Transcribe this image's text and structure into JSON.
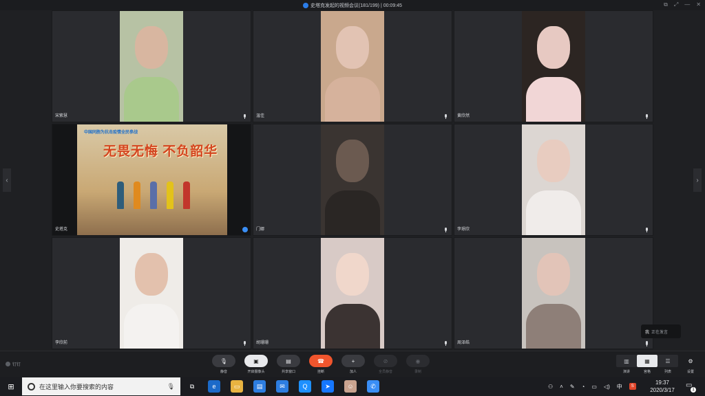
{
  "window": {
    "title": "史塔克发起的视频会议(181/199) | 00:09:45",
    "controls": [
      "⧉",
      "⤢",
      "—",
      "✕"
    ]
  },
  "participants": [
    {
      "name": "宋紫慧",
      "skin": "#d8b6a0",
      "bg": "#b7c2a4",
      "shirt": "#a9c98c"
    },
    {
      "name": "温佳",
      "skin": "#e2c3b3",
      "bg": "#c9a88d",
      "shirt": "#d6b29c"
    },
    {
      "name": "黄欣然",
      "skin": "#e7c9c2",
      "bg": "#2c2522",
      "shirt": "#f1d6d6"
    },
    {
      "name": "史塔克",
      "shared": true
    },
    {
      "name": "门娜",
      "skin": "#6b5a50",
      "bg": "#3a3431",
      "shirt": "#2a2624"
    },
    {
      "name": "李璟欣",
      "skin": "#e8ccc0",
      "bg": "#dcd6d2",
      "shirt": "#f0ecea"
    },
    {
      "name": "李欣前",
      "skin": "#e3c1ad",
      "bg": "#efece8",
      "shirt": "#f4f2f0"
    },
    {
      "name": "胡珊珊",
      "skin": "#f0d7cb",
      "bg": "#d8cac6",
      "shirt": "#3b3332"
    },
    {
      "name": "周泽皓",
      "skin": "#e2c4b8",
      "bg": "#c8c3be",
      "shirt": "#8e7f78"
    }
  ],
  "poster": {
    "banner": "中国同胞为抗击疫情全民参战",
    "slogan": "无畏无悔  不负韶华"
  },
  "nav": {
    "left": "‹",
    "right": "›"
  },
  "toast": {
    "speaker": "我",
    "status": "正在发言"
  },
  "toolbar": {
    "pin": "钉钉",
    "mute": {
      "label": "静音",
      "icon": "🎙"
    },
    "camera": {
      "label": "开启摄像头",
      "icon": "▣"
    },
    "share": {
      "label": "共享窗口",
      "icon": "▤"
    },
    "hangup": {
      "label": "挂断",
      "icon": "☎"
    },
    "add": {
      "label": "加人",
      "icon": "+"
    },
    "mute_all": {
      "label": "全员静音",
      "icon": "⊘"
    },
    "record": {
      "label": "录制",
      "icon": "◉"
    },
    "views": [
      {
        "label": "演讲",
        "icon": "▥",
        "active": false
      },
      {
        "label": "宫格",
        "icon": "▦",
        "active": true
      },
      {
        "label": "列表",
        "icon": "☰",
        "active": false
      }
    ],
    "settings": {
      "label": "设置",
      "icon": "⚙"
    }
  },
  "taskbar": {
    "search_placeholder": "在这里输入你要搜索的内容",
    "time": "19:37",
    "date": "2020/3/17",
    "ime": "中",
    "notifications": "1",
    "apps": [
      {
        "name": "task-view",
        "icon": "⧉",
        "color": "#1b1c20"
      },
      {
        "name": "edge",
        "icon": "e",
        "color": "#1b6ac9"
      },
      {
        "name": "file-explorer",
        "icon": "▭",
        "color": "#e8b341"
      },
      {
        "name": "store",
        "icon": "▤",
        "color": "#2d7de0"
      },
      {
        "name": "mail",
        "icon": "✉",
        "color": "#2d7de0"
      },
      {
        "name": "browser",
        "icon": "Q",
        "color": "#1e90ff"
      },
      {
        "name": "dingtalk",
        "icon": "➤",
        "color": "#1677ff"
      },
      {
        "name": "avatar-app",
        "icon": "☺",
        "color": "#c9a390"
      },
      {
        "name": "dingtalk-meeting",
        "icon": "✆",
        "color": "#3a8ef5"
      }
    ]
  },
  "colors": {
    "accent": "#3a8ef5",
    "hangup": "#f0552d"
  }
}
